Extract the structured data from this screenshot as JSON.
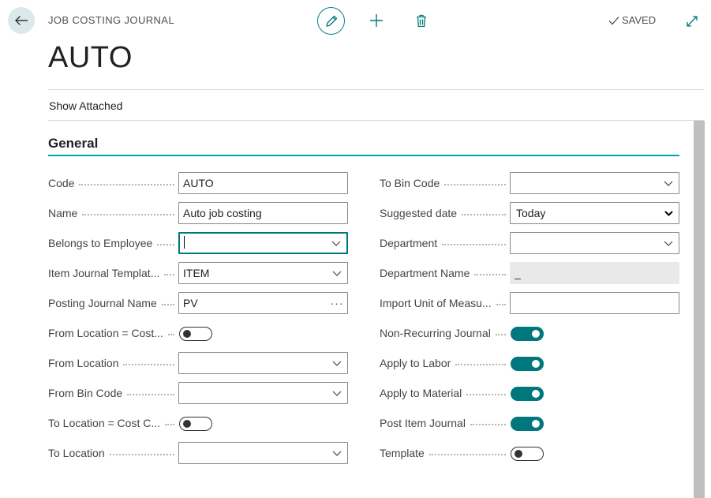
{
  "header": {
    "caption": "JOB COSTING JOURNAL",
    "saved_label": "SAVED",
    "title": "AUTO"
  },
  "actionbar": {
    "show_attached": "Show Attached"
  },
  "group": {
    "title": "General"
  },
  "left_fields": {
    "code": {
      "label": "Code",
      "value": "AUTO"
    },
    "name": {
      "label": "Name",
      "value": "Auto job costing"
    },
    "belongs_to_employee": {
      "label": "Belongs to Employee",
      "value": ""
    },
    "item_journal_template": {
      "label": "Item Journal Templat...",
      "value": "ITEM"
    },
    "posting_journal_name": {
      "label": "Posting Journal Name",
      "value": "PV"
    },
    "from_location_cost": {
      "label": "From Location = Cost...",
      "value": "off"
    },
    "from_location": {
      "label": "From Location",
      "value": ""
    },
    "from_bin_code": {
      "label": "From Bin Code",
      "value": ""
    },
    "to_location_cost": {
      "label": "To Location = Cost C...",
      "value": "off"
    },
    "to_location": {
      "label": "To Location",
      "value": ""
    }
  },
  "right_fields": {
    "to_bin_code": {
      "label": "To Bin Code",
      "value": ""
    },
    "suggested_date": {
      "label": "Suggested date",
      "value": "Today"
    },
    "department": {
      "label": "Department",
      "value": ""
    },
    "department_name": {
      "label": "Department Name",
      "value": "_"
    },
    "import_unit_of_measure": {
      "label": "Import Unit of Measu...",
      "value": ""
    },
    "non_recurring_journal": {
      "label": "Non-Recurring Journal",
      "value": "on"
    },
    "apply_to_labor": {
      "label": "Apply to Labor",
      "value": "on"
    },
    "apply_to_material": {
      "label": "Apply to Material",
      "value": "on"
    },
    "post_item_journal": {
      "label": "Post Item Journal",
      "value": "on"
    },
    "template": {
      "label": "Template",
      "value": "off"
    }
  },
  "icons": {
    "back": "arrow-left-icon",
    "edit": "pencil-icon",
    "new": "plus-icon",
    "delete": "trash-icon",
    "saved": "check-icon",
    "expand": "expand-icon",
    "dropdown": "chevron-down-icon",
    "lookup": "ellipsis-icon"
  },
  "colors": {
    "accent": "#00777c",
    "group_underline": "#00a4a9",
    "back_button_bg": "#dbe9ec",
    "readonly_bg": "#e9e9e9"
  }
}
